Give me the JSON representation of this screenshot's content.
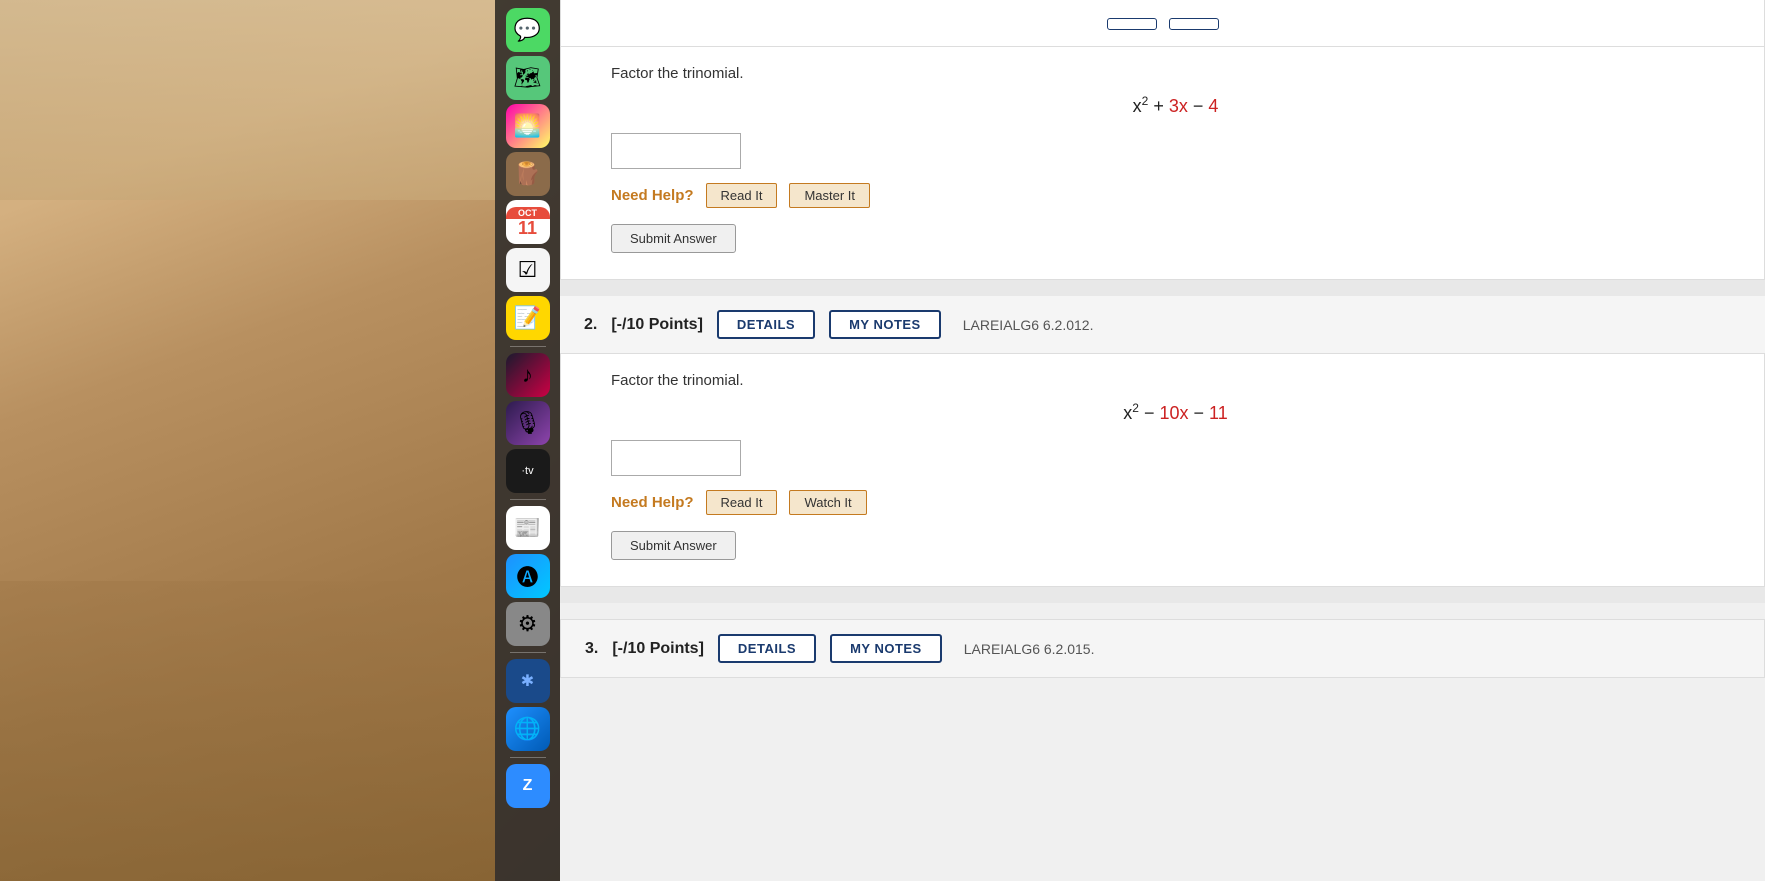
{
  "dock": {
    "icons": [
      {
        "name": "messages",
        "color": "#4cd964",
        "glyph": "💬"
      },
      {
        "name": "maps",
        "color": "#4cd964",
        "glyph": "🗺"
      },
      {
        "name": "photos",
        "color": "#f0a",
        "glyph": "🌅"
      },
      {
        "name": "contacts",
        "color": "#8b6b4a",
        "glyph": "🪵"
      },
      {
        "name": "calendar",
        "color": "#e74c3c",
        "glyph": "📅"
      },
      {
        "name": "reminders",
        "color": "#e74c3c",
        "glyph": "⬜"
      },
      {
        "name": "notes",
        "color": "#ffd700",
        "glyph": "📝"
      },
      {
        "name": "music",
        "color": "#e74c3c",
        "glyph": "🎵"
      },
      {
        "name": "podcasts",
        "color": "#8e44ad",
        "glyph": "🎙"
      },
      {
        "name": "appletv",
        "color": "#1a1a1a",
        "glyph": "📺"
      },
      {
        "name": "news",
        "color": "#e74c3c",
        "glyph": "📰"
      },
      {
        "name": "appstore",
        "color": "#1e90ff",
        "glyph": "🅐"
      },
      {
        "name": "settings",
        "color": "#555",
        "glyph": "⚙"
      },
      {
        "name": "bluetooth",
        "color": "#1a4a8a",
        "glyph": "⬡"
      },
      {
        "name": "safari",
        "color": "#1e90ff",
        "glyph": "🌐"
      },
      {
        "name": "zoom",
        "color": "#2d8cff",
        "glyph": "Z"
      }
    ]
  },
  "problems": {
    "problem1": {
      "intro": "Factor the trinomial.",
      "expression_html": "x² + 3x − 4",
      "need_help_label": "Need Help?",
      "read_it_label": "Read It",
      "master_it_label": "Master It",
      "submit_label": "Submit Answer"
    },
    "problem2": {
      "number": "2.",
      "points": "[-/10 Points]",
      "details_label": "DETAILS",
      "my_notes_label": "MY NOTES",
      "reference": "LAREIALG6 6.2.012.",
      "intro": "Factor the trinomial.",
      "expression_html": "x² − 10x − 11",
      "need_help_label": "Need Help?",
      "read_it_label": "Read It",
      "watch_it_label": "Watch It",
      "submit_label": "Submit Answer"
    },
    "problem3": {
      "number": "3.",
      "points": "[-/10 Points]",
      "details_label": "DETAILS",
      "my_notes_label": "MY NOTES",
      "reference": "LAREIALG6 6.2.015."
    }
  }
}
